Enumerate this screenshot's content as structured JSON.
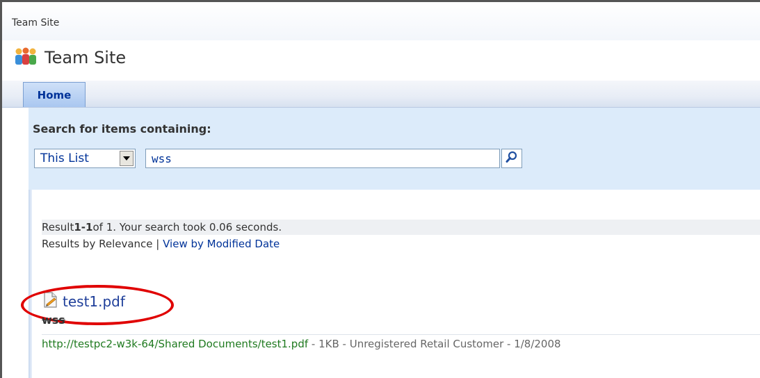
{
  "breadcrumb": "Team Site",
  "site_title": "Team Site",
  "nav": {
    "home_tab": "Home"
  },
  "search": {
    "heading": "Search for items containing:",
    "scope": "This List",
    "query": "wss"
  },
  "results": {
    "summary_prefix": "Result ",
    "summary_range": "1-1",
    "summary_suffix": " of 1. Your search took 0.06 seconds.",
    "sort_current": "Results by Relevance",
    "sort_separator": " | ",
    "sort_alt": "View by Modified Date",
    "items": [
      {
        "title": "test1.pdf",
        "snippet": "wss",
        "url": "http://testpc2-w3k-64/Shared Documents/test1.pdf",
        "details": " - 1KB - Unregistered Retail Customer - 1/8/2008"
      }
    ]
  },
  "colors": {
    "accent": "#003399",
    "url_green": "#1f7a1f",
    "highlight_red": "#e00000",
    "panel_blue": "#dcebfa"
  }
}
